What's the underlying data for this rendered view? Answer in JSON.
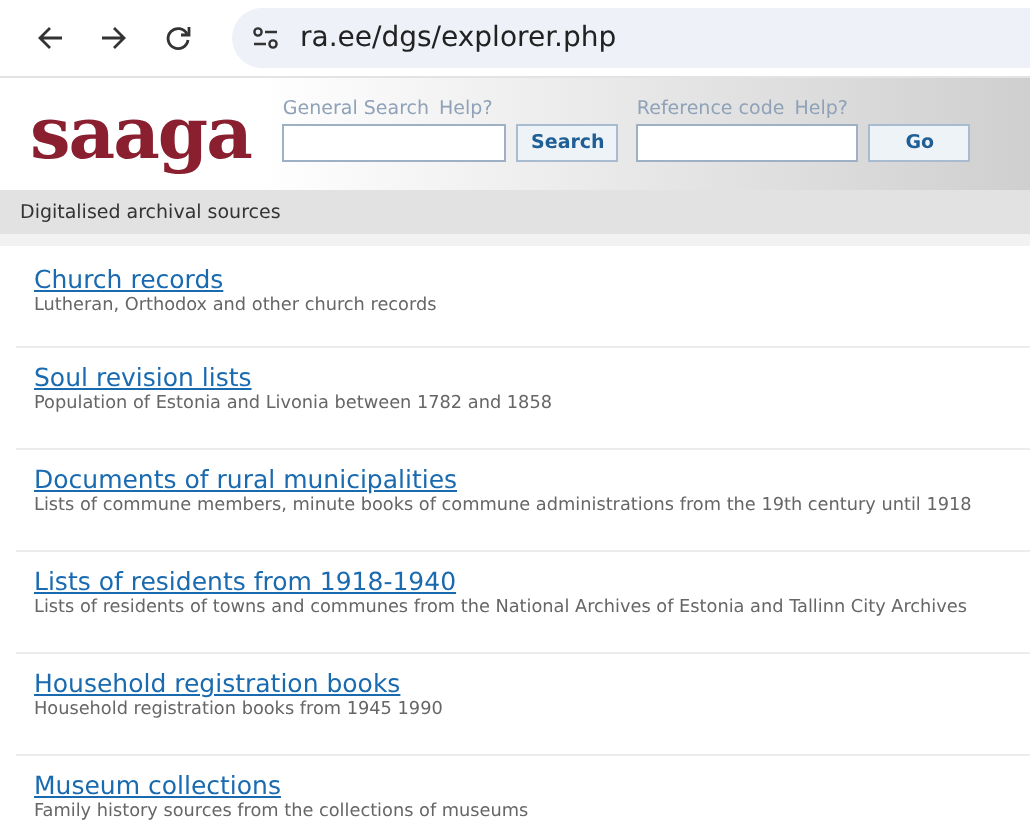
{
  "browser": {
    "url": "ra.ee/dgs/explorer.php"
  },
  "header": {
    "logo": "saaga",
    "general_search": {
      "label": "General Search",
      "help": "Help?",
      "button": "Search"
    },
    "reference_code": {
      "label": "Reference code",
      "help": "Help?",
      "button": "Go"
    }
  },
  "breadcrumb": "Digitalised archival sources",
  "sources": [
    {
      "title": "Church records",
      "description": "Lutheran, Orthodox and other church records"
    },
    {
      "title": "Soul revision lists",
      "description": "Population of Estonia and Livonia between 1782 and 1858"
    },
    {
      "title": "Documents of rural municipalities",
      "description": "Lists of commune members, minute books of commune administrations from the 19th century until 1918"
    },
    {
      "title": "Lists of residents from 1918-1940",
      "description": "Lists of residents of towns and communes from the National Archives of Estonia and Tallinn City Archives"
    },
    {
      "title": "Household registration books",
      "description": "Household registration books from 1945 1990"
    },
    {
      "title": "Museum collections",
      "description": "Family history sources from the collections of museums"
    }
  ]
}
